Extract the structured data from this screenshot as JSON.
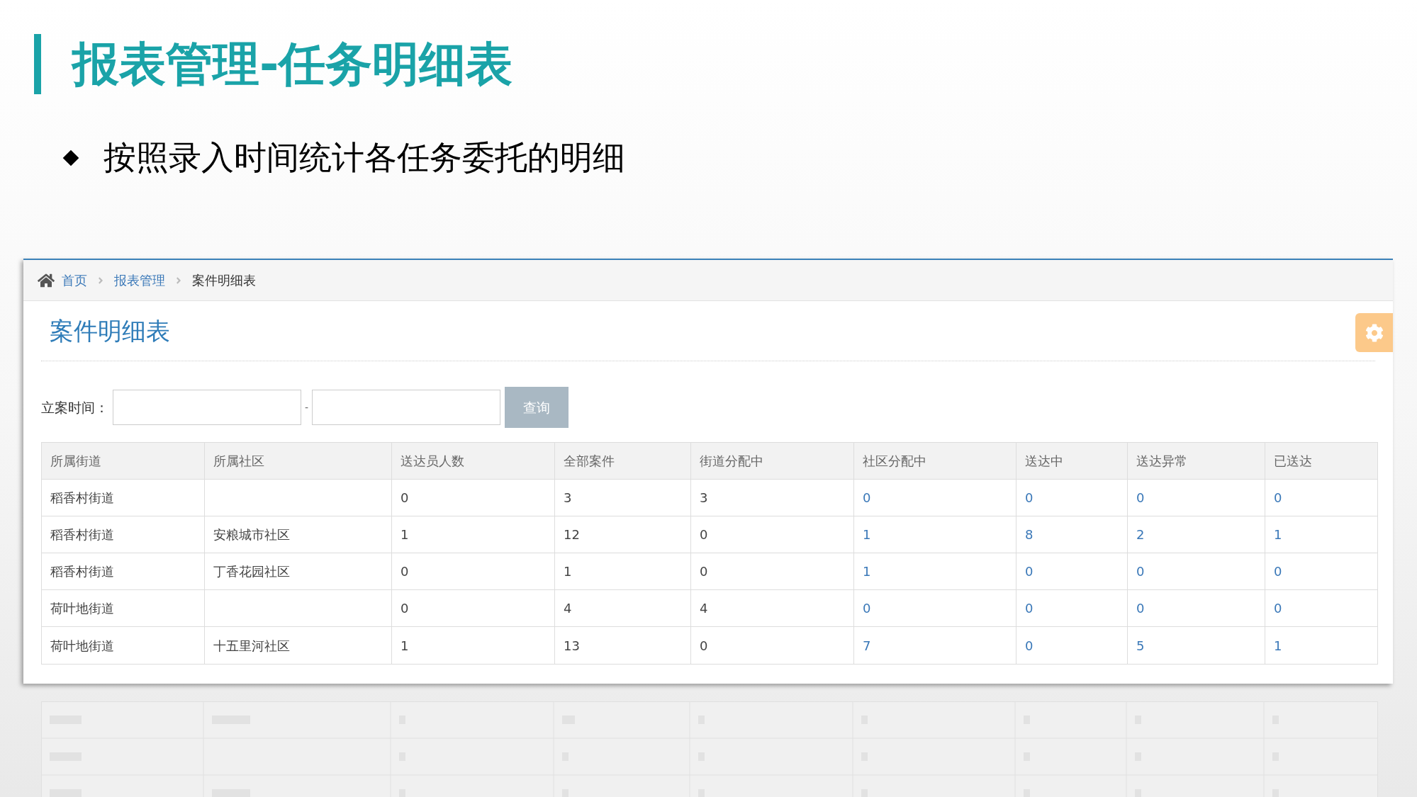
{
  "slide": {
    "title": "报表管理-任务明细表",
    "bullet": "按照录入时间统计各任务委托的明细"
  },
  "breadcrumb": [
    {
      "label": "首页",
      "link": true
    },
    {
      "label": "报表管理",
      "link": true
    },
    {
      "label": "案件明细表",
      "link": false
    }
  ],
  "page_title": "案件明细表",
  "filter": {
    "label": "立案时间：",
    "separator": "-",
    "button": "查询"
  },
  "table": {
    "columns": [
      {
        "label": "所属街道",
        "link": false
      },
      {
        "label": "所属社区",
        "link": false
      },
      {
        "label": "送达员人数",
        "link": false
      },
      {
        "label": "全部案件",
        "link": false
      },
      {
        "label": "街道分配中",
        "link": false
      },
      {
        "label": "社区分配中",
        "link": true
      },
      {
        "label": "送达中",
        "link": true
      },
      {
        "label": "送达异常",
        "link": true
      },
      {
        "label": "已送达",
        "link": true
      }
    ],
    "rows": [
      [
        "稻香村街道",
        "",
        "0",
        "3",
        "3",
        "0",
        "0",
        "0",
        "0"
      ],
      [
        "稻香村街道",
        "安粮城市社区",
        "1",
        "12",
        "0",
        "1",
        "8",
        "2",
        "1"
      ],
      [
        "稻香村街道",
        "丁香花园社区",
        "0",
        "1",
        "0",
        "1",
        "0",
        "0",
        "0"
      ],
      [
        "荷叶地街道",
        "",
        "0",
        "4",
        "4",
        "0",
        "0",
        "0",
        "0"
      ],
      [
        "荷叶地街道",
        "十五里河社区",
        "1",
        "13",
        "0",
        "7",
        "0",
        "5",
        "1"
      ]
    ]
  }
}
